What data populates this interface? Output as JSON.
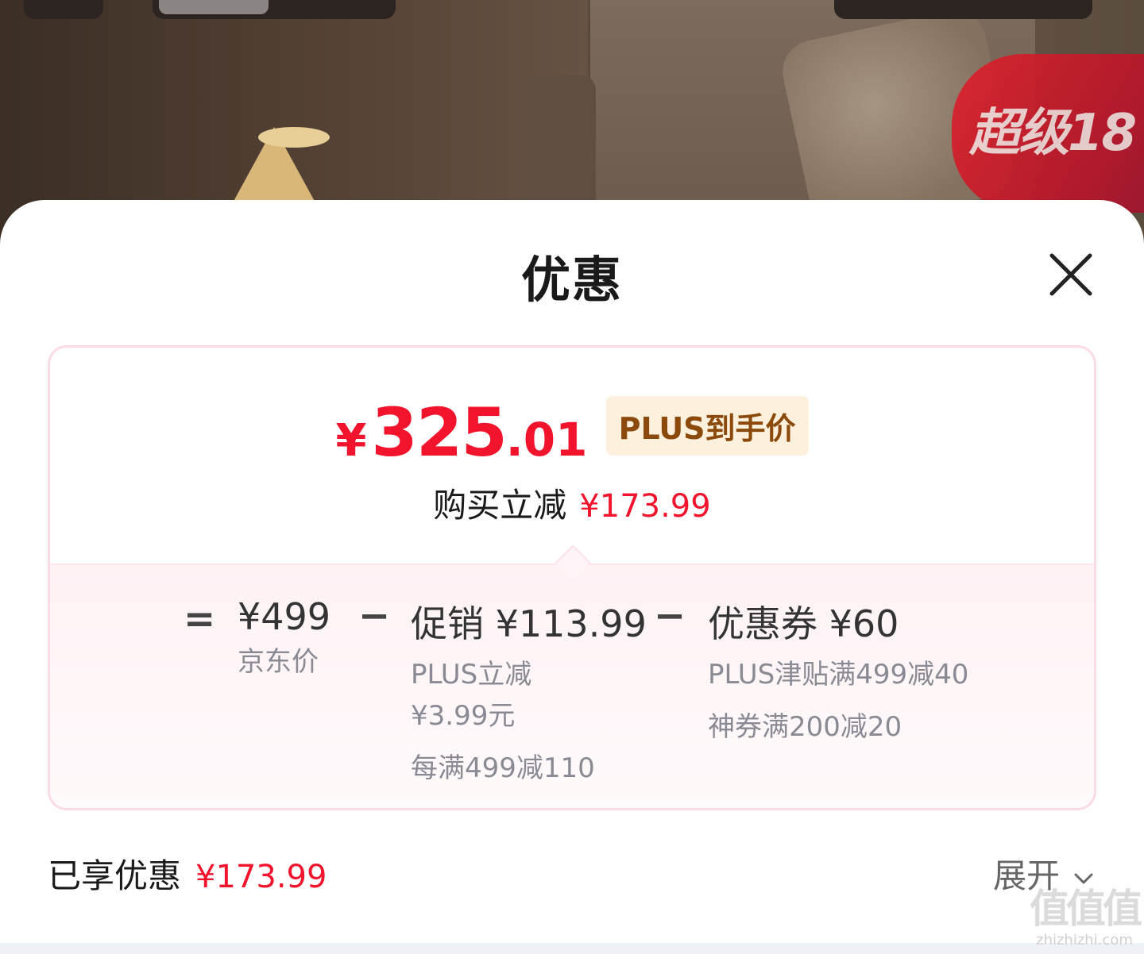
{
  "background": {
    "promo_badge_text": "超级18"
  },
  "sheet": {
    "title": "优惠",
    "close_icon": "close-icon"
  },
  "price_card": {
    "currency": "¥",
    "price_integer": "325",
    "price_decimal": ".01",
    "plus_tag": "PLUS到手价",
    "reduce_label": "购买立减",
    "reduce_amount": "¥173.99",
    "breakdown": {
      "equals": "=",
      "minus": "−",
      "base": {
        "amount": "¥499",
        "label": "京东价"
      },
      "promotion": {
        "amount": "促销 ¥113.99",
        "details": [
          "PLUS立减",
          "¥3.99元",
          "每满499减110"
        ]
      },
      "coupon": {
        "amount": "优惠券 ¥60",
        "details": [
          "PLUS津贴满499减40",
          "神券满200减20"
        ]
      }
    }
  },
  "summary": {
    "label": "已享优惠",
    "amount": "¥173.99",
    "expand_label": "展开",
    "expand_icon": "chevron-down-icon"
  },
  "watermark": {
    "glyphs": "值值值",
    "url": "zhizhizhi.com"
  },
  "colors": {
    "price_red": "#f2142c",
    "tag_bg": "#fdf0dc",
    "tag_text": "#8b4a0c",
    "card_border": "#fbdbe5",
    "muted": "#8a8a94"
  }
}
